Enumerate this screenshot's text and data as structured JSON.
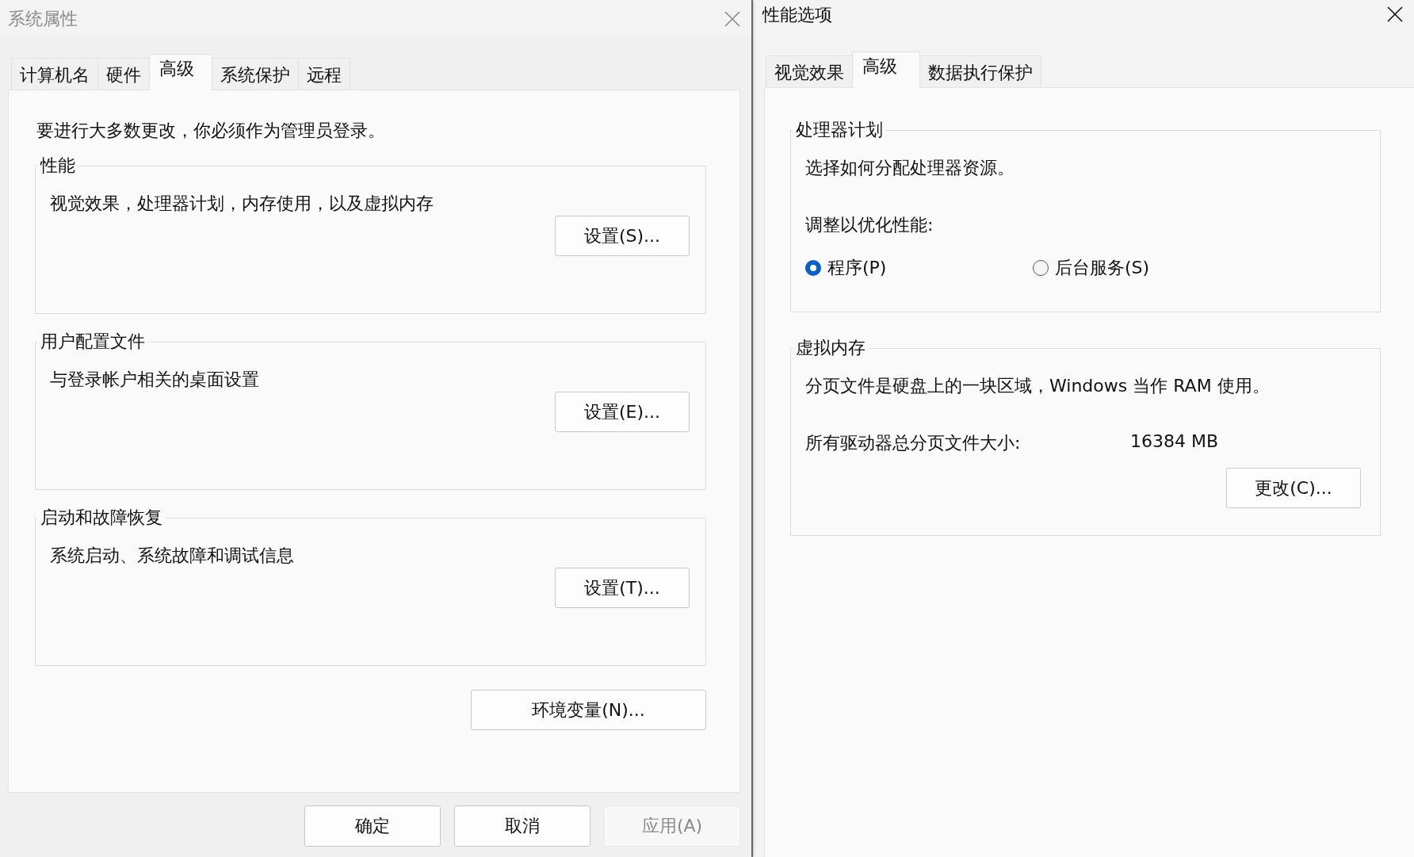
{
  "system_properties": {
    "title": "系统属性",
    "tabs": [
      {
        "label": "计算机名",
        "selected": false
      },
      {
        "label": "硬件",
        "selected": false
      },
      {
        "label": "高级",
        "selected": true
      },
      {
        "label": "系统保护",
        "selected": false
      },
      {
        "label": "远程",
        "selected": false
      }
    ],
    "notice": "要进行大多数更改，你必须作为管理员登录。",
    "groups": [
      {
        "title": "性能",
        "description": "视觉效果，处理器计划，内存使用，以及虚拟内存",
        "button": "设置(S)..."
      },
      {
        "title": "用户配置文件",
        "description": "与登录帐户相关的桌面设置",
        "button": "设置(E)..."
      },
      {
        "title": "启动和故障恢复",
        "description": "系统启动、系统故障和调试信息",
        "button": "设置(T)..."
      }
    ],
    "env_button": "环境变量(N)...",
    "buttons": [
      {
        "label": "确定",
        "disabled": false
      },
      {
        "label": "取消",
        "disabled": false
      },
      {
        "label": "应用(A)",
        "disabled": true
      }
    ]
  },
  "performance_options": {
    "title": "性能选项",
    "tabs": [
      {
        "label": "视觉效果",
        "selected": false
      },
      {
        "label": "高级",
        "selected": true
      },
      {
        "label": "数据执行保护",
        "selected": false
      }
    ],
    "processor_scheduling": {
      "title": "处理器计划",
      "description": "选择如何分配处理器资源。",
      "adjust_label": "调整以优化性能:",
      "options": [
        {
          "label": "程序(P)",
          "selected": true
        },
        {
          "label": "后台服务(S)",
          "selected": false
        }
      ]
    },
    "virtual_memory": {
      "title": "虚拟内存",
      "description": "分页文件是硬盘上的一块区域，Windows 当作 RAM 使用。",
      "total_label": "所有驱动器总分页文件大小:",
      "total_value": "16384 MB",
      "button": "更改(C)..."
    }
  }
}
